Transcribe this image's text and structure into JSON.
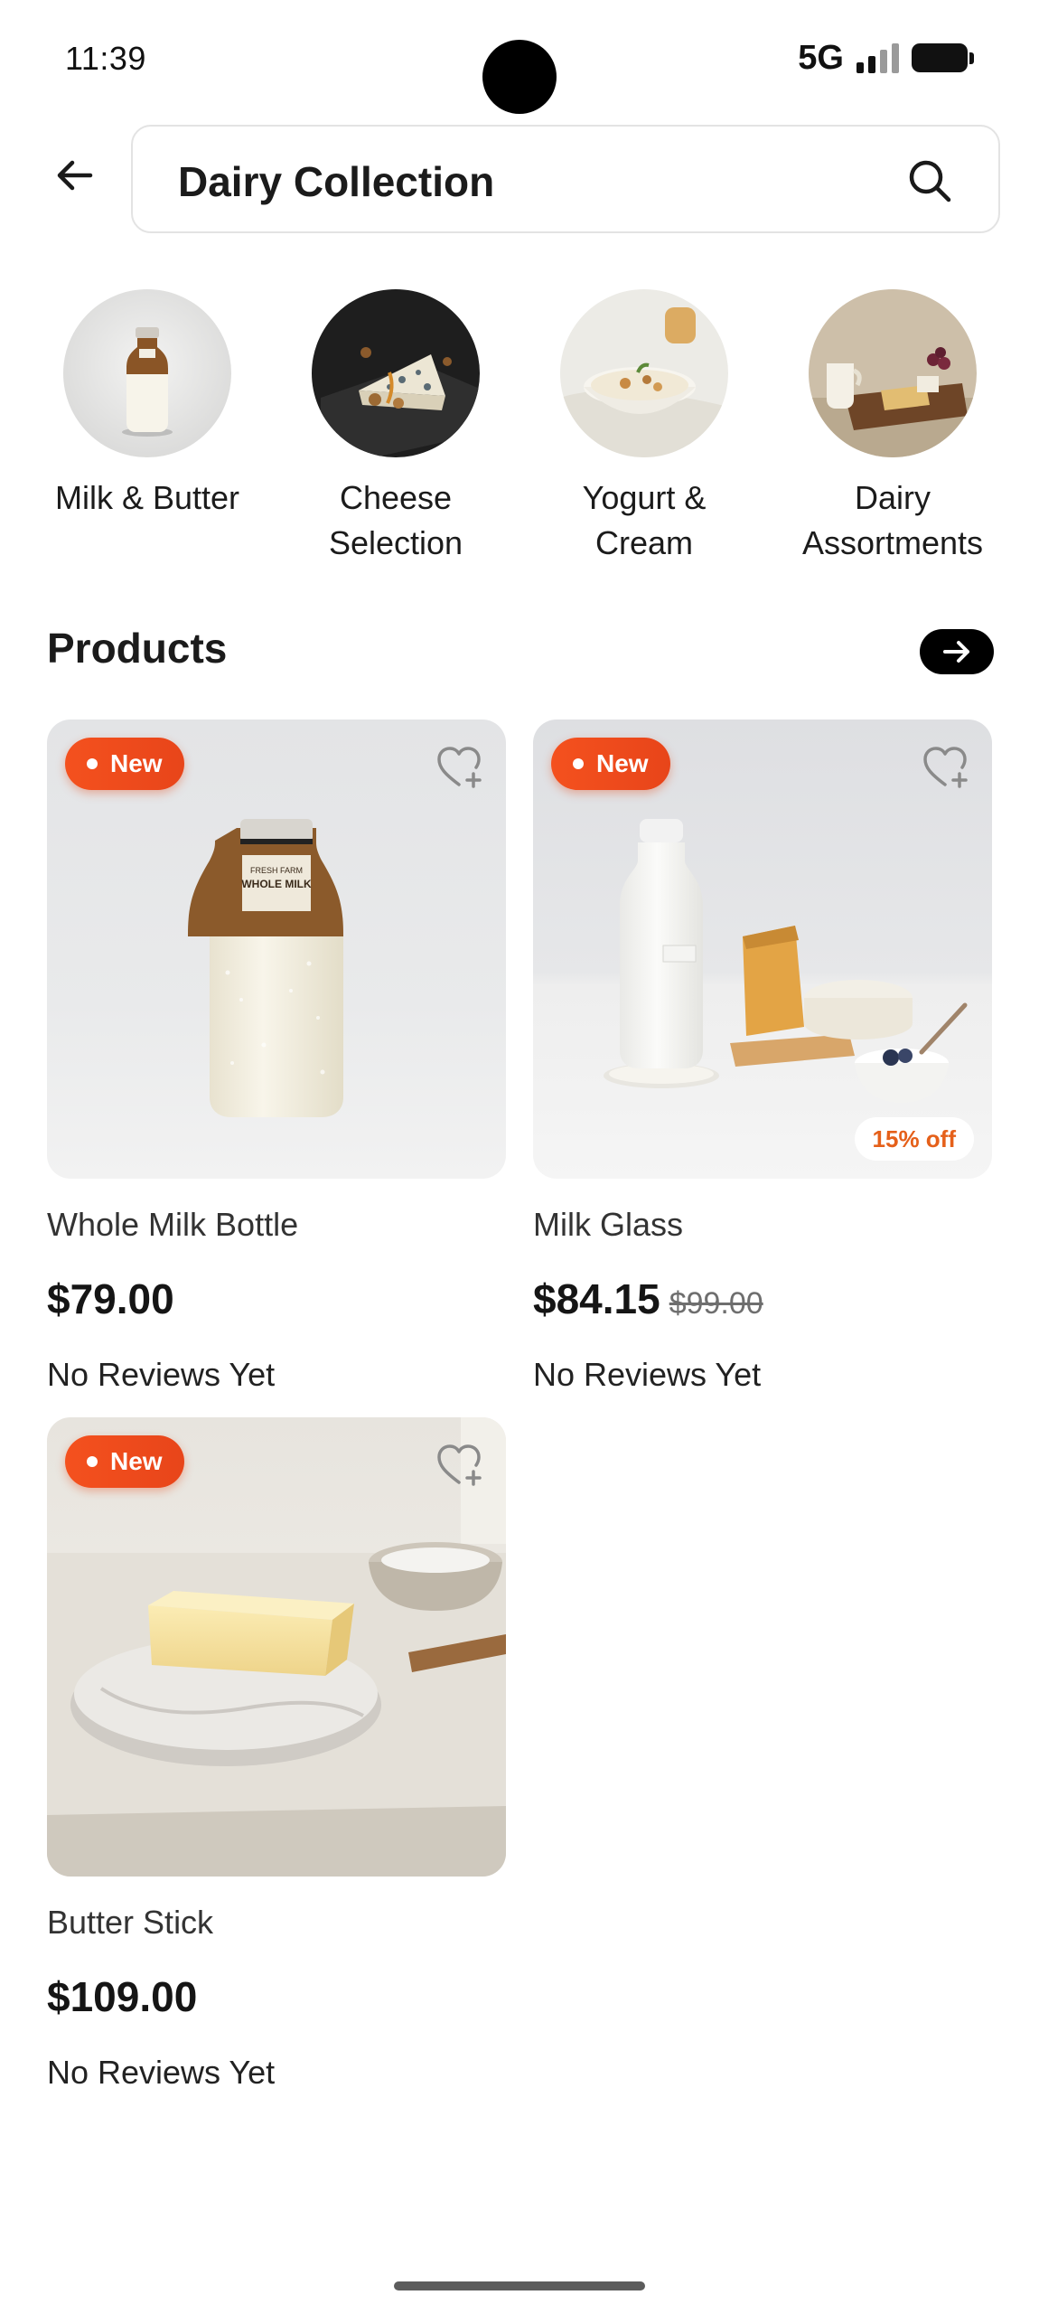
{
  "status_bar": {
    "time": "11:39",
    "network": "5G",
    "signal_level": 3,
    "signal_max": 4,
    "icons": [
      "signal-icon",
      "battery-icon"
    ]
  },
  "header": {
    "back_icon": "arrow-left-icon",
    "search_text": "Dairy Collection",
    "search_icon": "search-icon"
  },
  "categories": [
    {
      "label": "Milk & Butter"
    },
    {
      "label": "Cheese\nSelection"
    },
    {
      "label": "Yogurt &\nCream"
    },
    {
      "label": "Dairy\nAssortments"
    }
  ],
  "products_section": {
    "title": "Products",
    "see_all_icon": "arrow-right-icon"
  },
  "products": [
    {
      "badge": "New",
      "name": "Whole Milk Bottle",
      "price": "$79.00",
      "old_price": "",
      "discount": "",
      "reviews": "No Reviews Yet",
      "bottle_label_lines": [
        "FRESH FARM",
        "WHOLE MILK"
      ]
    },
    {
      "badge": "New",
      "name": "Milk Glass",
      "price": "$84.15",
      "old_price": "$99.00",
      "discount": "15% off",
      "reviews": "No Reviews Yet"
    },
    {
      "badge": "New",
      "name": "Butter Stick",
      "price": "$109.00",
      "old_price": "",
      "discount": "",
      "reviews": "No Reviews Yet"
    }
  ],
  "colors": {
    "badge": "#f4511e",
    "discount_text": "#e5601a",
    "see_all_bg": "#000000"
  }
}
